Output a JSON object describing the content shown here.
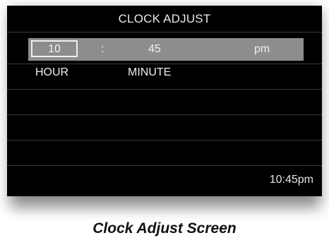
{
  "screen": {
    "title": "CLOCK ADJUST",
    "time_bar": {
      "hour_value": "10",
      "separator": ":",
      "minute_value": "45",
      "period": "pm"
    },
    "labels": {
      "hour": "HOUR",
      "minute": "MINUTE"
    },
    "status_time": "10:45pm"
  },
  "caption": "Clock Adjust Screen",
  "colors": {
    "screen_background": "#000000",
    "selection_bar": "#8d8d8d",
    "text": "#e8e8e8"
  }
}
